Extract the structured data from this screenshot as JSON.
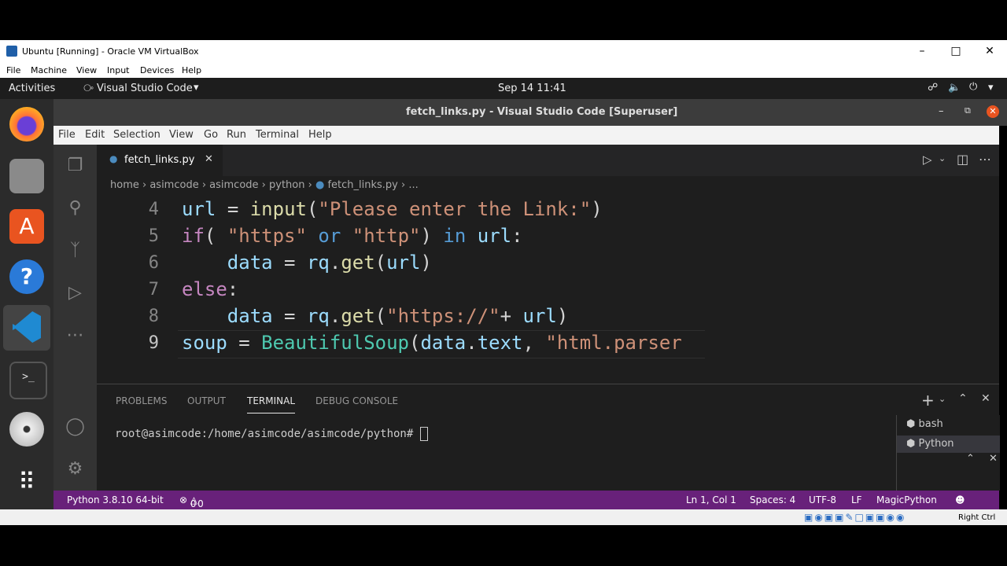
{
  "vbox": {
    "title": "Ubuntu [Running] - Oracle VM VirtualBox",
    "menu": [
      "File",
      "Machine",
      "View",
      "Input",
      "Devices",
      "Help"
    ],
    "host_key": "Right Ctrl"
  },
  "ubuntu": {
    "activities": "Activities",
    "app_menu": "Visual Studio Code",
    "clock": "Sep 14  11:41"
  },
  "vscode": {
    "window_title": "fetch_links.py - Visual Studio Code [Superuser]",
    "menu": [
      "File",
      "Edit",
      "Selection",
      "View",
      "Go",
      "Run",
      "Terminal",
      "Help"
    ],
    "tab": "fetch_links.py",
    "breadcrumb": [
      "home",
      "asimcode",
      "asimcode",
      "python",
      "fetch_links.py",
      "..."
    ],
    "lines": [
      {
        "n": "4",
        "text": "url = input(\"Please enter the Link:\")"
      },
      {
        "n": "5",
        "text": "if( \"https\" or \"http\") in url:"
      },
      {
        "n": "6",
        "text": "    data = rq.get(url)"
      },
      {
        "n": "7",
        "text": "else:"
      },
      {
        "n": "8",
        "text": "    data = rq.get(\"https://\"+ url)"
      },
      {
        "n": "9",
        "text": "soup = BeautifulSoup(data.text, \"html.parser"
      }
    ],
    "panel_tabs": [
      "PROBLEMS",
      "OUTPUT",
      "TERMINAL",
      "DEBUG CONSOLE"
    ],
    "active_panel_tab": "TERMINAL",
    "terminal_prompt": "root@asimcode:/home/asimcode/asimcode/python# ",
    "terminals": [
      "bash",
      "Python"
    ],
    "status": {
      "interpreter": "Python 3.8.10 64-bit",
      "errors": "0",
      "warnings": "0",
      "position": "Ln 1, Col 1",
      "spaces": "Spaces: 4",
      "encoding": "UTF-8",
      "eol": "LF",
      "language": "MagicPython"
    }
  },
  "colors": {
    "status_bar": "#68217a",
    "editor_bg": "#1e1e1e"
  }
}
